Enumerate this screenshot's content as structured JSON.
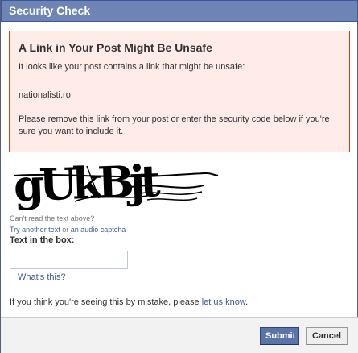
{
  "dialog": {
    "title": "Security Check"
  },
  "warning": {
    "title": "A Link in Your Post Might Be Unsafe",
    "line1": "It looks like your post contains a link that might be unsafe:",
    "url": "nationalisti.ro",
    "line3": "Please remove this link from your post or enter the security code below if you're sure you want to include it."
  },
  "captcha": {
    "text": "gUkBjt",
    "cant_read": "Can't read the text above?",
    "try_another": "Try another text",
    "or": " or ",
    "audio": "an audio captcha",
    "box_label": "Text in the box:",
    "input_value": "",
    "whats_this": "What's this?"
  },
  "mistake": {
    "prefix": "If you think you're seeing this by mistake, please ",
    "link": "let us know",
    "suffix": "."
  },
  "buttons": {
    "submit": "Submit",
    "cancel": "Cancel"
  },
  "colors": {
    "title_bar": "#6d84b4",
    "warning_bg": "#ffebe8",
    "warning_border": "#dd3c10",
    "link": "#3b5998",
    "submit_bg": "#5b74a8"
  }
}
